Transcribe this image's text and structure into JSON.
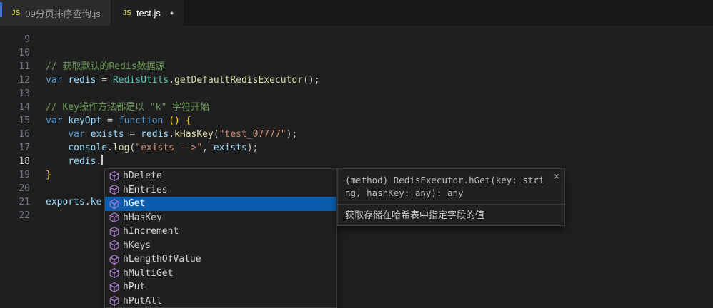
{
  "colors": {
    "selection_blue": "#0b5cad",
    "method_icon_purple": "#b180d7",
    "js_icon_yellow": "#cbcb41",
    "accent_blue": "#3e6fd0"
  },
  "tabs": [
    {
      "icon": "JS",
      "label": "09分页排序查询.js",
      "active": false,
      "modified": false
    },
    {
      "icon": "JS",
      "label": "test.js",
      "active": true,
      "modified": true,
      "dot": "●"
    }
  ],
  "editor": {
    "lines": [
      {
        "num": 9,
        "tokens": []
      },
      {
        "num": 10,
        "tokens": []
      },
      {
        "num": 11,
        "tokens": [
          {
            "t": "cmt",
            "x": "// 获取默认的Redis数据源"
          }
        ]
      },
      {
        "num": 12,
        "tokens": [
          {
            "t": "kw",
            "x": "var"
          },
          {
            "t": "pl",
            "x": " "
          },
          {
            "t": "var",
            "x": "redis"
          },
          {
            "t": "pl",
            "x": " = "
          },
          {
            "t": "cls",
            "x": "RedisUtils"
          },
          {
            "t": "pl",
            "x": "."
          },
          {
            "t": "fn",
            "x": "getDefaultRedisExecutor"
          },
          {
            "t": "pl",
            "x": "();"
          }
        ]
      },
      {
        "num": 13,
        "tokens": []
      },
      {
        "num": 14,
        "tokens": [
          {
            "t": "cmt",
            "x": "// Key操作方法都是以 \"k\" 字符开始"
          }
        ]
      },
      {
        "num": 15,
        "tokens": [
          {
            "t": "kw",
            "x": "var"
          },
          {
            "t": "pl",
            "x": " "
          },
          {
            "t": "var",
            "x": "keyOpt"
          },
          {
            "t": "pl",
            "x": " = "
          },
          {
            "t": "kw",
            "x": "function"
          },
          {
            "t": "pl",
            "x": " "
          },
          {
            "t": "br",
            "x": "()"
          },
          {
            "t": "pl",
            "x": " "
          },
          {
            "t": "br",
            "x": "{"
          }
        ]
      },
      {
        "num": 16,
        "tokens": [
          {
            "t": "pl",
            "x": "    "
          },
          {
            "t": "kw",
            "x": "var"
          },
          {
            "t": "pl",
            "x": " "
          },
          {
            "t": "var",
            "x": "exists"
          },
          {
            "t": "pl",
            "x": " = "
          },
          {
            "t": "var",
            "x": "redis"
          },
          {
            "t": "pl",
            "x": "."
          },
          {
            "t": "fn",
            "x": "kHasKey"
          },
          {
            "t": "pl",
            "x": "("
          },
          {
            "t": "str",
            "x": "\"test_07777\""
          },
          {
            "t": "pl",
            "x": ");"
          }
        ]
      },
      {
        "num": 17,
        "tokens": [
          {
            "t": "pl",
            "x": "    "
          },
          {
            "t": "var",
            "x": "console"
          },
          {
            "t": "pl",
            "x": "."
          },
          {
            "t": "fn",
            "x": "log"
          },
          {
            "t": "pl",
            "x": "("
          },
          {
            "t": "str",
            "x": "\"exists -->\""
          },
          {
            "t": "pl",
            "x": ", "
          },
          {
            "t": "var",
            "x": "exists"
          },
          {
            "t": "pl",
            "x": ");"
          }
        ]
      },
      {
        "num": 18,
        "current": true,
        "caret": true,
        "tokens": [
          {
            "t": "pl",
            "x": "    "
          },
          {
            "t": "var",
            "x": "redis"
          },
          {
            "t": "pl",
            "x": "."
          }
        ]
      },
      {
        "num": 19,
        "tokens": [
          {
            "t": "br",
            "x": "}"
          }
        ]
      },
      {
        "num": 20,
        "tokens": []
      },
      {
        "num": 21,
        "tokens": [
          {
            "t": "var",
            "x": "exports"
          },
          {
            "t": "pl",
            "x": "."
          },
          {
            "t": "var",
            "x": "ke"
          }
        ]
      },
      {
        "num": 22,
        "tokens": []
      }
    ]
  },
  "suggest": {
    "selected_index": 2,
    "items": [
      {
        "label": "hDelete"
      },
      {
        "label": "hEntries"
      },
      {
        "label": "hGet"
      },
      {
        "label": "hHasKey"
      },
      {
        "label": "hIncrement"
      },
      {
        "label": "hKeys"
      },
      {
        "label": "hLengthOfValue"
      },
      {
        "label": "hMultiGet"
      },
      {
        "label": "hPut"
      },
      {
        "label": "hPutAll"
      }
    ],
    "doc": {
      "signature": "(method) RedisExecutor.hGet(key: string, hashKey: any): any",
      "description": "获取存储在哈希表中指定字段的值",
      "close_label": "×"
    }
  }
}
